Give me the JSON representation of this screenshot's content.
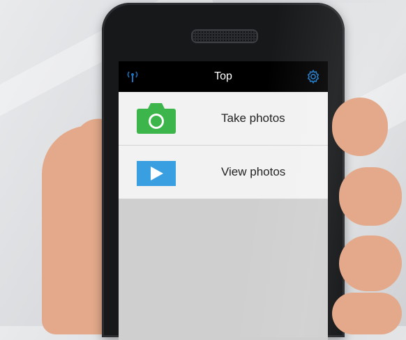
{
  "app": {
    "title": "Top",
    "status_icon": "antenna-icon",
    "settings_icon": "gear-icon",
    "accent_color": "#1e73be"
  },
  "menu": {
    "items": [
      {
        "label": "Take photos",
        "icon": "camera-icon",
        "icon_color": "#3cb54a"
      },
      {
        "label": "View photos",
        "icon": "play-icon",
        "icon_color": "#3a9fe0"
      }
    ]
  }
}
